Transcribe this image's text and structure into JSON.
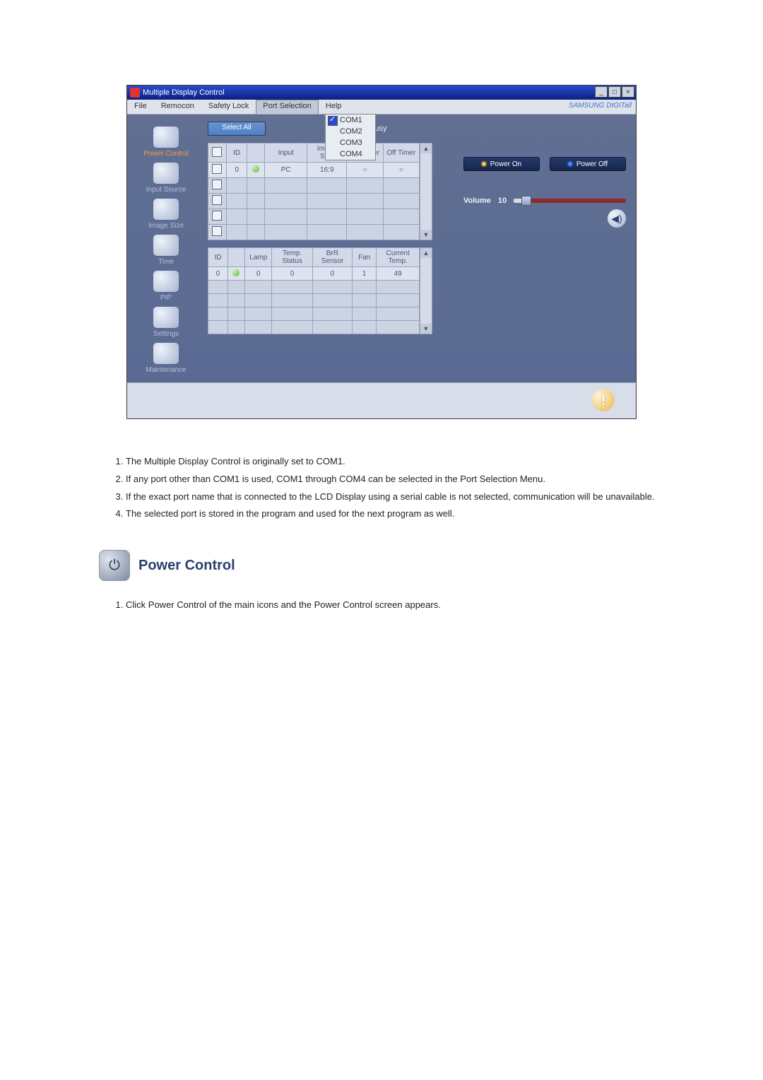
{
  "window": {
    "title": "Multiple Display Control",
    "brand": "SAMSUNG DIGITall"
  },
  "menu": {
    "items": [
      "File",
      "Remocon",
      "Safety Lock",
      "Port Selection",
      "Help"
    ],
    "open_index": 3
  },
  "port_dropdown": {
    "items": [
      "COM1",
      "COM2",
      "COM3",
      "COM4"
    ],
    "selected_index": 0
  },
  "sidebar": {
    "items": [
      {
        "label": "Power Control",
        "active": true
      },
      {
        "label": "Input Source",
        "active": false
      },
      {
        "label": "Image Size",
        "active": false
      },
      {
        "label": "Time",
        "active": false
      },
      {
        "label": "PIP",
        "active": false
      },
      {
        "label": "Settings",
        "active": false
      },
      {
        "label": "Maintenance",
        "active": false
      }
    ]
  },
  "toolbar": {
    "select_all": "Select All",
    "busy": "Busy"
  },
  "table1": {
    "headers": [
      "",
      "ID",
      "",
      "Input",
      "Image Size",
      "On Timer",
      "Off Timer"
    ],
    "row": {
      "id": "0",
      "status": "green",
      "input": "PC",
      "image_size": "16:9",
      "on_timer": "○",
      "off_timer": "○"
    }
  },
  "table2": {
    "headers": [
      "ID",
      "",
      "Lamp",
      "Temp. Status",
      "BrR Sensor",
      "Fan",
      "Current Temp."
    ],
    "row": {
      "id": "0",
      "status": "green",
      "lamp": "0",
      "temp_status": "0",
      "br_sensor": "0",
      "fan": "1",
      "current_temp": "49"
    }
  },
  "rightpanel": {
    "power_on": "Power On",
    "power_off": "Power Off",
    "volume_label": "Volume",
    "volume_value": "10"
  },
  "doc": {
    "list": [
      "The Multiple Display Control is originally set to COM1.",
      "If any port other than COM1 is used, COM1 through COM4 can be selected in the Port Selection Menu.",
      "If the exact port name that is connected to the LCD Display using a serial cable is not selected, communication will be unavailable.",
      "The selected port is stored in the program and used for the next program as well."
    ],
    "section_title": "Power Control",
    "sub_list": [
      "Click Power Control of the main icons and the Power Control screen appears."
    ]
  }
}
